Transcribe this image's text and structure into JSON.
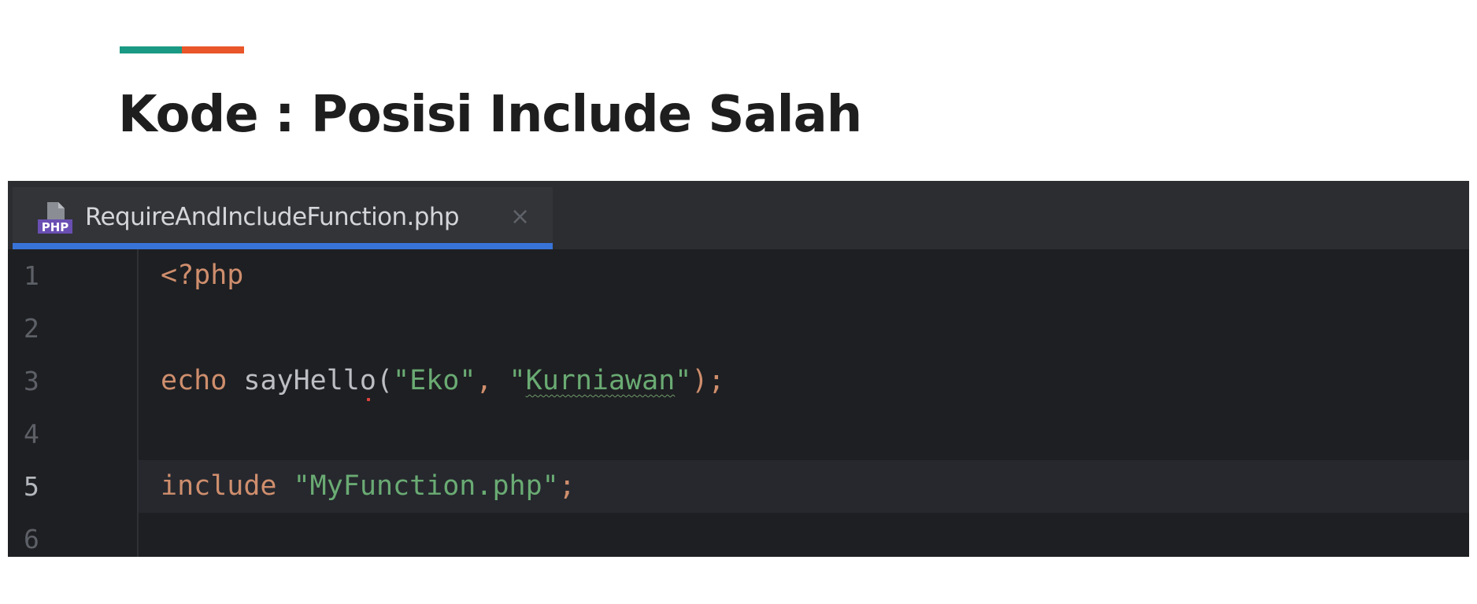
{
  "slide": {
    "title": "Kode : Posisi Include Salah",
    "accent_colors": [
      "#1a9a84",
      "#e8562a"
    ]
  },
  "editor": {
    "tab": {
      "icon": "php-file-icon",
      "icon_label": "PHP",
      "filename": "RequireAndIncludeFunction.php",
      "close_glyph": "×",
      "active": true
    },
    "current_line": 5,
    "line_numbers": [
      "1",
      "2",
      "3",
      "4",
      "5",
      "6"
    ],
    "lines": [
      [
        {
          "text": "<?php",
          "kind": "kw"
        }
      ],
      [],
      [
        {
          "text": "echo",
          "kind": "kw"
        },
        {
          "text": " ",
          "kind": "plain"
        },
        {
          "text": "sayHello",
          "kind": "fn"
        },
        {
          "text": "(",
          "kind": "plain"
        },
        {
          "text": "\"Eko\"",
          "kind": "str"
        },
        {
          "text": ", ",
          "kind": "kw"
        },
        {
          "text": "\"",
          "kind": "str"
        },
        {
          "text": "Kurniawan",
          "kind": "str-squiggle"
        },
        {
          "text": "\"",
          "kind": "str"
        },
        {
          "text": ");",
          "kind": "kw"
        }
      ],
      [],
      [
        {
          "text": "include",
          "kind": "kw"
        },
        {
          "text": " ",
          "kind": "plain"
        },
        {
          "text": "\"MyFunction.php\"",
          "kind": "str"
        },
        {
          "text": ";",
          "kind": "kw"
        }
      ],
      []
    ],
    "colors": {
      "background": "#1e1f22",
      "tab_active_underline": "#3874d8",
      "keyword": "#cf8e6d",
      "string": "#6aab73",
      "identifier": "#bcbec4"
    }
  }
}
